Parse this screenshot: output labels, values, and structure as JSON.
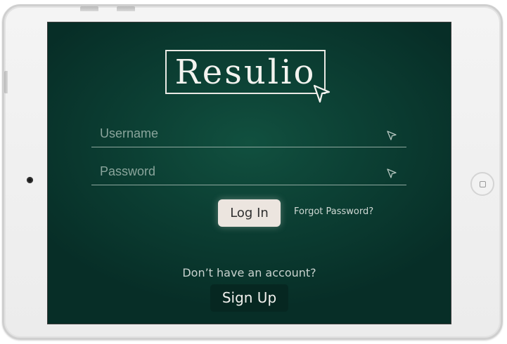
{
  "app": {
    "logo_text": "Resulio"
  },
  "login_form": {
    "username_placeholder": "Username",
    "password_placeholder": "Password",
    "login_label": "Log In",
    "forgot_password_label": "Forgot Password?"
  },
  "signup": {
    "prompt": "Don’t have an account?",
    "button_label": "Sign Up"
  },
  "icons": {
    "logo_cursor": "cursor-arrow-icon",
    "username_field": "cursor-arrow-icon",
    "password_field": "cursor-arrow-icon",
    "home_button": "home-square-icon"
  },
  "colors": {
    "screen_background": "#0c4034",
    "logo_text": "#f3f3ef",
    "login_button_bg": "#ece5df",
    "signup_button_bg": "#062721",
    "field_underline": "#8ea89f"
  }
}
